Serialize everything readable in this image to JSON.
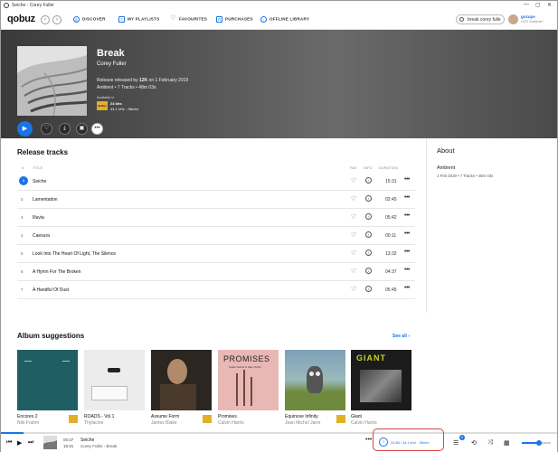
{
  "window": {
    "title": "Seiche - Corey Fuller",
    "controls": [
      "—",
      "▢",
      "✕"
    ]
  },
  "nav": {
    "logo": "qobuz",
    "items": [
      {
        "label": "DISCOVER",
        "icon": "compass-icon"
      },
      {
        "label": "MY PLAYLISTS",
        "icon": "playlist-icon"
      },
      {
        "label": "FAVOURITES",
        "icon": "heart-icon"
      },
      {
        "label": "PURCHASES",
        "icon": "bag-icon"
      },
      {
        "label": "OFFLINE LIBRARY",
        "icon": "download-icon"
      }
    ],
    "search_value": "break corey fulle",
    "user_name": "gozupe",
    "user_plan": "Hi-Fi Sublime+"
  },
  "album": {
    "title": "Break",
    "artist": "Corey Fuller",
    "release_prefix": "Release released by ",
    "label": "12K",
    "release_suffix": " on 1 February 2019",
    "meta": "Ambient • 7 Tracks • 48m 03s",
    "available_in": "Available in",
    "quality_bits": "24 bits",
    "quality_rate": "44.1 kHz - Stereo",
    "badge": "Hi-Res"
  },
  "tracks_section": {
    "title": "Release tracks",
    "headers": {
      "num": "#",
      "title": "TITLE",
      "fav": "FAV",
      "info": "INFO",
      "duration": "DURATION"
    },
    "rows": [
      {
        "num": "1",
        "title": "Seiche",
        "duration": "15:31",
        "playing": true
      },
      {
        "num": "2",
        "title": "Lamentation",
        "duration": "02:45",
        "playing": false
      },
      {
        "num": "3",
        "title": "Illuvia",
        "duration": "05:42",
        "playing": false
      },
      {
        "num": "4",
        "title": "Caesura",
        "duration": "00:11",
        "playing": false
      },
      {
        "num": "5",
        "title": "Look Into The Heart Of Light, The Silence",
        "duration": "13:32",
        "playing": false
      },
      {
        "num": "6",
        "title": "A Hymn For The Broken",
        "duration": "04:37",
        "playing": false
      },
      {
        "num": "7",
        "title": "A Handful Of Dust",
        "duration": "05:45",
        "playing": false
      }
    ]
  },
  "about": {
    "title": "About",
    "genre": "Ambient",
    "meta": "1 Feb 2019 • 7 Tracks • 48m 03s"
  },
  "suggestions": {
    "title": "Album suggestions",
    "see_all": "See all ›",
    "items": [
      {
        "title": "Encores 2",
        "artist": "Nils Frahm",
        "cover_color": "#1f5e63",
        "hires": true
      },
      {
        "title": "ROADS - Vol.1",
        "artist": "Thylacine",
        "cover_color": "#e9e9e9",
        "hires": false
      },
      {
        "title": "Assume Form",
        "artist": "James Blake",
        "cover_color": "#2c2620",
        "hires": true
      },
      {
        "title": "Promises",
        "artist": "Calvin Harris",
        "cover_color": "#e9b8b5",
        "hires": false
      },
      {
        "title": "Equinoxe Infinity",
        "artist": "Jean Michel Jarre",
        "cover_color": "#6f8a3c",
        "hires": true
      },
      {
        "title": "Giant",
        "artist": "Calvin Harris",
        "cover_color": "#1b1b1b",
        "hires": false
      }
    ],
    "cover_text": {
      "promises": "PROMISES",
      "promises_sub": "Calvin Harris & Sam Smith",
      "giant": "GIANT"
    }
  },
  "player": {
    "elapsed": "00:37",
    "total": "15:31",
    "title": "Seiche",
    "subtitle": "Corey Fuller - Break",
    "quality_text": "24-Bit / 44.1 kHz - Stereo",
    "queue_count": "6",
    "progress": 0.04,
    "volume": 0.6
  },
  "colors": {
    "accent": "#1a73e8",
    "hires": "#e0b028",
    "highlight": "#d64541"
  }
}
